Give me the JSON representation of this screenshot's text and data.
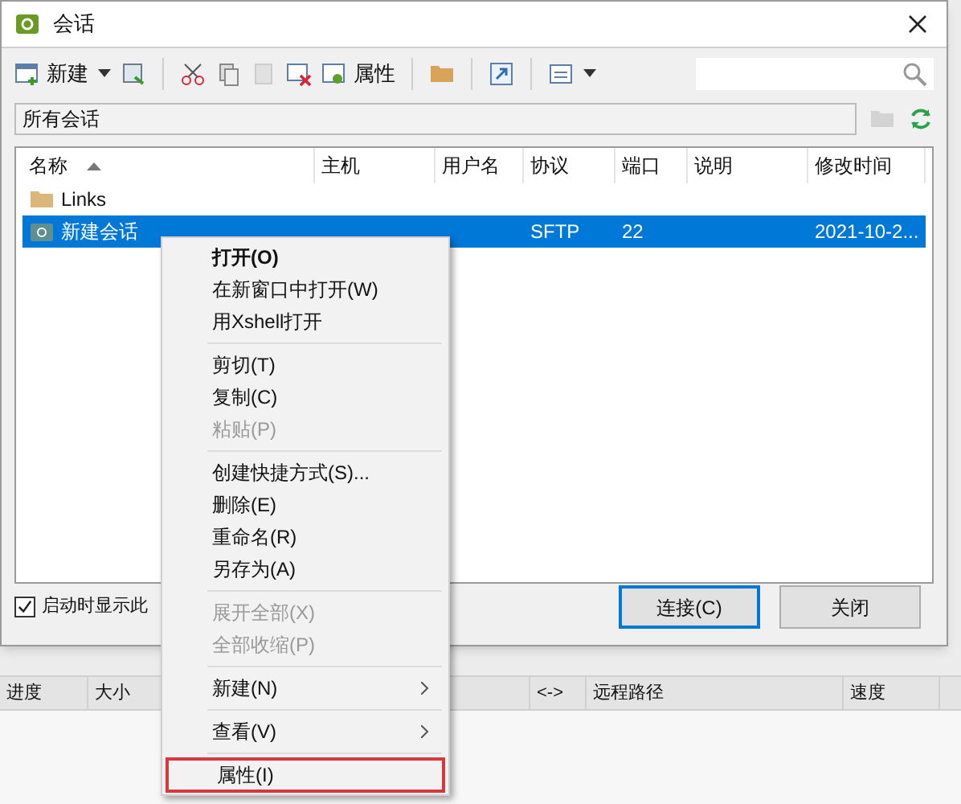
{
  "window": {
    "title": "会话"
  },
  "toolbar": {
    "new_label": "新建",
    "properties_label": "属性"
  },
  "path_bar": {
    "value": "所有会话"
  },
  "table": {
    "columns": [
      {
        "label": "名称",
        "sorted": true
      },
      {
        "label": "主机",
        "sorted": false
      },
      {
        "label": "用户名",
        "sorted": false
      },
      {
        "label": "协议",
        "sorted": false
      },
      {
        "label": "端口",
        "sorted": false
      },
      {
        "label": "说明",
        "sorted": false
      },
      {
        "label": "修改时间",
        "sorted": false
      }
    ],
    "rows": [
      {
        "kind": "folder",
        "selected": false,
        "cells": [
          "Links",
          "",
          "",
          "",
          "",
          "",
          ""
        ]
      },
      {
        "kind": "session",
        "selected": true,
        "cells": [
          "新建会话",
          "",
          "",
          "SFTP",
          "22",
          "",
          "2021-10-2..."
        ]
      }
    ]
  },
  "startup_checkbox": {
    "label": "启动时显示此",
    "checked": true
  },
  "buttons": [
    {
      "label": "连接(C)",
      "default": true
    },
    {
      "label": "关闭",
      "default": false
    }
  ],
  "transfer_columns": [
    "进度",
    "大小",
    "<->",
    "远程路径",
    "速度"
  ],
  "context_menu": [
    {
      "kind": "item",
      "label": "打开(O)",
      "bold": true,
      "disabled": false,
      "submenu": false,
      "highlighted": false
    },
    {
      "kind": "item",
      "label": "在新窗口中打开(W)",
      "bold": false,
      "disabled": false,
      "submenu": false,
      "highlighted": false
    },
    {
      "kind": "item",
      "label": "用Xshell打开",
      "bold": false,
      "disabled": false,
      "submenu": false,
      "highlighted": false
    },
    {
      "kind": "separator"
    },
    {
      "kind": "item",
      "label": "剪切(T)",
      "bold": false,
      "disabled": false,
      "submenu": false,
      "highlighted": false
    },
    {
      "kind": "item",
      "label": "复制(C)",
      "bold": false,
      "disabled": false,
      "submenu": false,
      "highlighted": false
    },
    {
      "kind": "item",
      "label": "粘贴(P)",
      "bold": false,
      "disabled": true,
      "submenu": false,
      "highlighted": false
    },
    {
      "kind": "separator"
    },
    {
      "kind": "item",
      "label": "创建快捷方式(S)...",
      "bold": false,
      "disabled": false,
      "submenu": false,
      "highlighted": false
    },
    {
      "kind": "item",
      "label": "删除(E)",
      "bold": false,
      "disabled": false,
      "submenu": false,
      "highlighted": false
    },
    {
      "kind": "item",
      "label": "重命名(R)",
      "bold": false,
      "disabled": false,
      "submenu": false,
      "highlighted": false
    },
    {
      "kind": "item",
      "label": "另存为(A)",
      "bold": false,
      "disabled": false,
      "submenu": false,
      "highlighted": false
    },
    {
      "kind": "separator"
    },
    {
      "kind": "item",
      "label": "展开全部(X)",
      "bold": false,
      "disabled": true,
      "submenu": false,
      "highlighted": false
    },
    {
      "kind": "item",
      "label": "全部收缩(P)",
      "bold": false,
      "disabled": true,
      "submenu": false,
      "highlighted": false
    },
    {
      "kind": "separator"
    },
    {
      "kind": "item",
      "label": "新建(N)",
      "bold": false,
      "disabled": false,
      "submenu": true,
      "highlighted": false
    },
    {
      "kind": "separator"
    },
    {
      "kind": "item",
      "label": "查看(V)",
      "bold": false,
      "disabled": false,
      "submenu": true,
      "highlighted": false
    },
    {
      "kind": "separator"
    },
    {
      "kind": "item",
      "label": "属性(I)",
      "bold": false,
      "disabled": false,
      "submenu": false,
      "highlighted": true
    }
  ]
}
